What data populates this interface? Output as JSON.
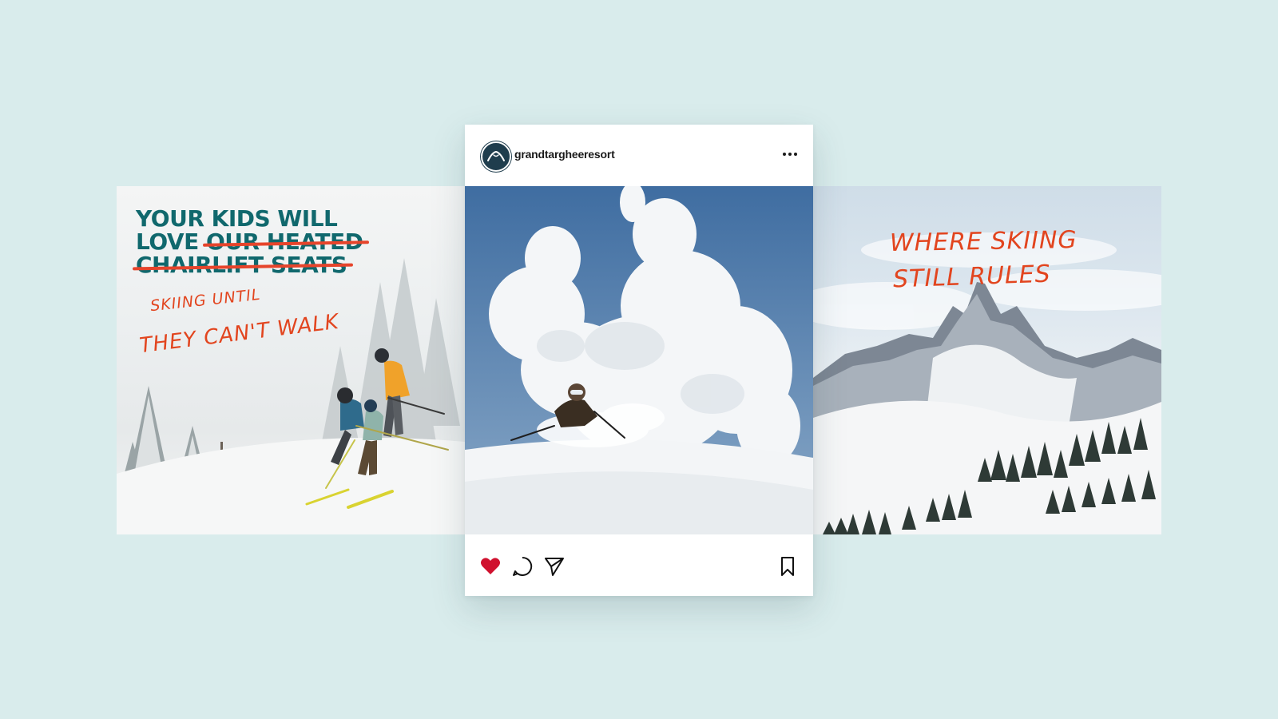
{
  "left_ad": {
    "headline_line1": "YOUR KIDS WILL",
    "headline_line2_kept": "LOVE",
    "headline_line2_struck": "OUR HEATED",
    "headline_line3_struck": "CHAIRLIFT SEATS",
    "handwritten_line1": "SKIING UNTIL",
    "handwritten_line2": "THEY CAN'T WALK"
  },
  "post": {
    "username": "grandtargheeresort",
    "avatar_icon": "mountain-logo-icon",
    "more_icon": "more-dots-icon",
    "actions": {
      "like_icon": "heart-filled-icon",
      "comment_icon": "comment-bubble-icon",
      "share_icon": "paper-plane-icon",
      "save_icon": "bookmark-icon"
    },
    "liked": true
  },
  "right_ad": {
    "handwritten_line1": "WHERE SKIING",
    "handwritten_line2": "STILL RULES"
  },
  "colors": {
    "background": "#d9ecec",
    "headline_teal": "#10686d",
    "handwriting_orange": "#e2451f",
    "like_red": "#d0112e",
    "avatar_navy": "#1f3d4d"
  }
}
